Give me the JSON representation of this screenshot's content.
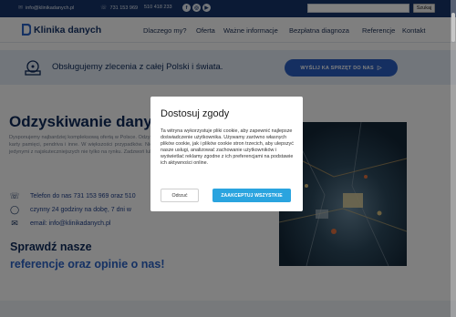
{
  "topbar": {
    "email": "info@klinikadanych.pl",
    "phone1": "731 153 969",
    "phone2": "510 418 233",
    "social": [
      "f",
      "◎",
      "▶"
    ],
    "search_placeholder": "",
    "search_button": "Szukaj"
  },
  "header": {
    "logo_text": "Klinika danych",
    "nav": [
      "Dlaczego my?",
      "Oferta",
      "Ważne informacje",
      "Bezpłatna diagnoza",
      "Referencje",
      "Kontakt"
    ]
  },
  "banner": {
    "text": "Obsługujemy zlecenia z całej Polski i świata.",
    "button": "WYŚLIJ KA SPRZĘT DO NAS"
  },
  "main": {
    "heading": "Odzyskiwanie dany",
    "paragraph": "Dysponujemy najbardziej kompleksową ofertą w Polsce. Odzyskujemy dane z każdego rodzaju nośnika: dysku, serwera, karty pamięci, pendriva i inne. W większości przypadków. Nie jesteśmy najtańszą firmą, choć możemy być. Jesteśmy jedynymi z najskuteczniejszych nie tylko na rynku. Zadzwoń lub napisz do nas aby zweryfikować naszą ofertę.",
    "contacts": [
      {
        "icon": "phone-icon",
        "text": "Telefon do nas 731 153 969 oraz 510"
      },
      {
        "icon": "whatsapp-icon",
        "text": "czynny 24 godziny na dobę, 7 dni w"
      },
      {
        "icon": "mail-icon",
        "text": "email: info@klinikadanych.pl"
      }
    ],
    "ref_line1": "Sprawdź nasze",
    "ref_line2": "referencje oraz opinie o nas!"
  },
  "colors": {
    "navy": "#16356b",
    "accent_blue": "#2a5ec2",
    "cookie_accept": "#2aa4df",
    "banner_bg": "#e4edf6"
  },
  "cookie_modal": {
    "title": "Dostosuj zgody",
    "body": "Ta witryna wykorzystuje pliki cookie, aby zapewnić najlepsze doświadczenie użytkownika. Używamy zarówno własnych plików cookie, jak i plików cookie stron trzecich, aby ulepszyć nasze usługi, analizować zachowanie użytkowników i wyświetlać reklamy zgodne z ich preferencjami na podstawie ich aktywności online.",
    "reject_label": "Odrzuć",
    "accept_label": "ZAAKCEPTUJ WSZYSTKIE"
  }
}
